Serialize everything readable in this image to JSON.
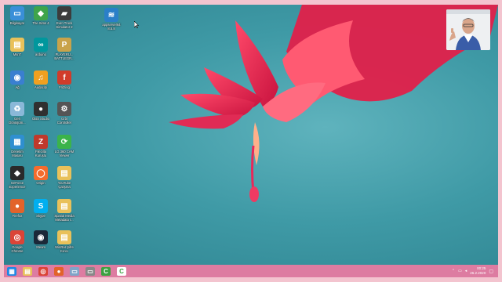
{
  "desktop": {
    "icons": [
      {
        "label": "Bilgisayar",
        "color": "#3a8fd8",
        "glyph": "▭"
      },
      {
        "label": "MsnT",
        "color": "#e9c15a",
        "glyph": "▤"
      },
      {
        "label": "Ağ",
        "color": "#3a7fd0",
        "glyph": "◉"
      },
      {
        "label": "Geri\nDönüşüm...",
        "color": "#8ab8d8",
        "glyph": "♻"
      },
      {
        "label": "Denetim\nMasası",
        "color": "#2f8fd0",
        "glyph": "▦"
      },
      {
        "label": "GeForce\nExperience",
        "color": "#2a2a2a",
        "glyph": "◆"
      },
      {
        "label": "Firefox",
        "color": "#e2632a",
        "glyph": "●"
      },
      {
        "label": "Google\nChrome",
        "color": "#db4437",
        "glyph": "◎"
      },
      {
        "label": "The Sims 4",
        "color": "#3fa44a",
        "glyph": "◆"
      },
      {
        "label": "arduino",
        "color": "#00979d",
        "glyph": "∞"
      },
      {
        "label": "Audacity",
        "color": "#f0a020",
        "glyph": "♫"
      },
      {
        "label": "OBS Studio",
        "color": "#303030",
        "glyph": "●"
      },
      {
        "label": "Filezilla\nKuruşlu",
        "color": "#c0392b",
        "glyph": "Z"
      },
      {
        "label": "Origin",
        "color": "#f56c2d",
        "glyph": "◯"
      },
      {
        "label": "Skype",
        "color": "#00aff0",
        "glyph": "S"
      },
      {
        "label": "Steam",
        "color": "#1b2838",
        "glyph": "◉"
      },
      {
        "label": "Euro Truck\nSimulator 2",
        "color": "#3c3c3c",
        "glyph": "▰"
      },
      {
        "label": "PLAYERU...\nBATTLEGR...",
        "color": "#c9a34a",
        "glyph": "P"
      },
      {
        "label": "Fritzing",
        "color": "#d13b2a",
        "glyph": "f"
      },
      {
        "label": "Grbl\nController",
        "color": "#555555",
        "glyph": "⚙"
      },
      {
        "label": "LG 360 CAM\nViewer",
        "color": "#3bb34a",
        "glyph": "⟳"
      },
      {
        "label": "YouTube\nÇalışma",
        "color": "#e9c15a",
        "glyph": "▤"
      },
      {
        "label": "Spatial Media\nMetadata I...",
        "color": "#e9c15a",
        "glyph": "▤"
      },
      {
        "label": "WinRar Şifre\nKırıcı",
        "color": "#e9c15a",
        "glyph": "▤"
      },
      {
        "label": "appserver64\n8.5.8",
        "color": "#2a7fc8",
        "glyph": "≋"
      }
    ]
  },
  "taskbar": {
    "items": [
      {
        "name": "start",
        "color": "#1e88e5",
        "glyph": "▦"
      },
      {
        "name": "file-explorer",
        "color": "#e9c15a",
        "glyph": "▤"
      },
      {
        "name": "chrome",
        "color": "#db4437",
        "glyph": "◎"
      },
      {
        "name": "firefox",
        "color": "#e2632a",
        "glyph": "●"
      },
      {
        "name": "app-window",
        "color": "#7fa4c8",
        "glyph": "▭"
      },
      {
        "name": "app-grey",
        "color": "#888888",
        "glyph": "▭"
      },
      {
        "name": "camtasia-green",
        "color": "#3ca141",
        "glyph": "C"
      },
      {
        "name": "camtasia-white",
        "color": "#ffffff",
        "glyph": "C"
      }
    ],
    "clock": {
      "time": "00:25",
      "date": "26.2.2020"
    }
  }
}
